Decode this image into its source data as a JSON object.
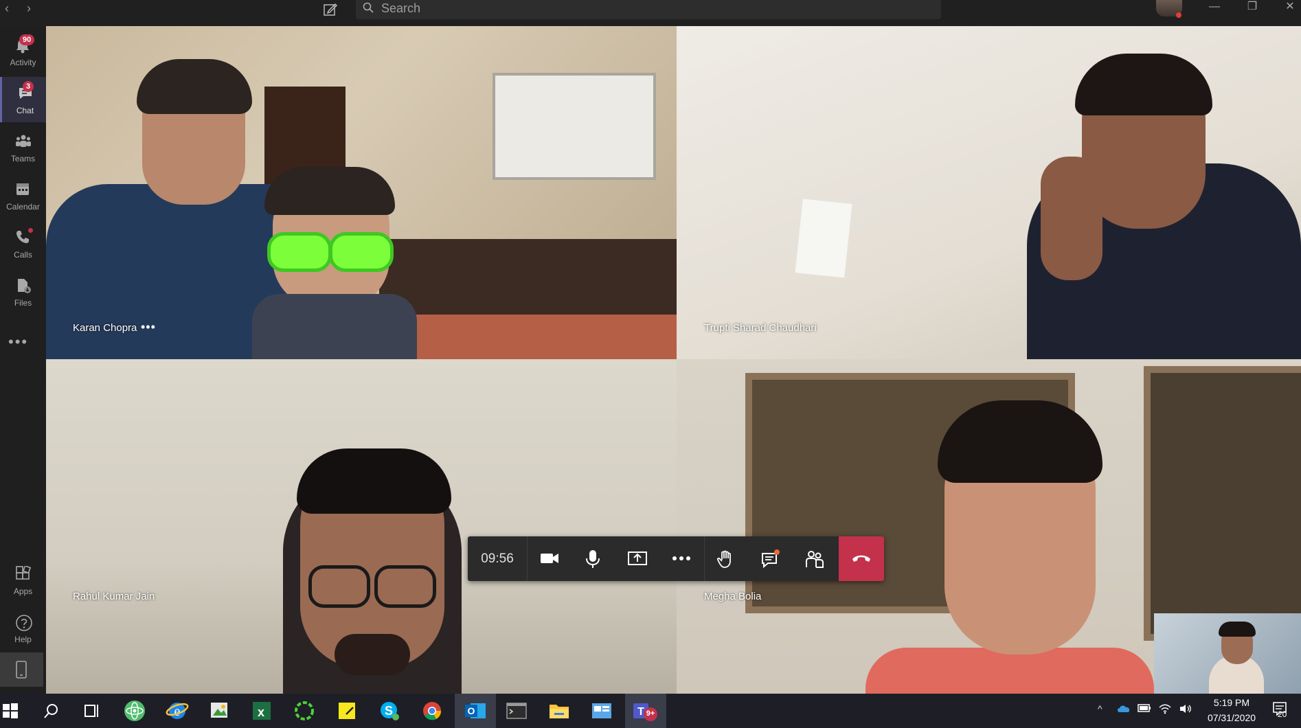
{
  "titlebar": {
    "search_placeholder": "Search"
  },
  "rail": {
    "items": [
      {
        "label": "Activity",
        "badge": "90"
      },
      {
        "label": "Chat",
        "badge": "3"
      },
      {
        "label": "Teams"
      },
      {
        "label": "Calendar"
      },
      {
        "label": "Calls"
      },
      {
        "label": "Files"
      }
    ],
    "bottom_items": [
      {
        "label": "Apps"
      },
      {
        "label": "Help"
      }
    ]
  },
  "participants": [
    {
      "name": "Karan Chopra"
    },
    {
      "name": "Trupti Sharad Chaudhari"
    },
    {
      "name": "Rahul Kumar Jain"
    },
    {
      "name": "Megha Bolia"
    }
  ],
  "call_toolbar": {
    "duration": "09:56"
  },
  "taskbar": {
    "time": "5:19 PM",
    "date": "07/31/2020",
    "notification_count": "20",
    "teams_badge": "9+"
  },
  "colors": {
    "accent": "#6264a7",
    "hangup": "#c4314b",
    "badge": "#c4314b"
  }
}
